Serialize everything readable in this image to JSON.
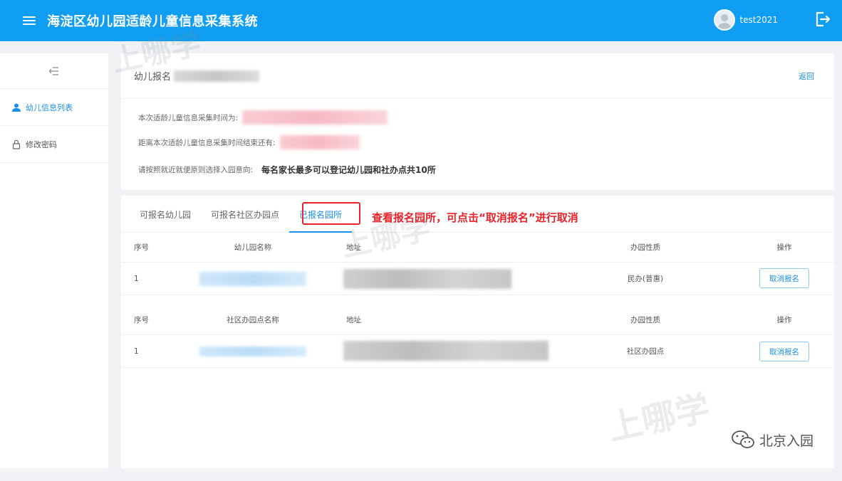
{
  "header": {
    "title": "海淀区幼儿园适龄儿童信息采集系统",
    "username": "test2021"
  },
  "sidebar": {
    "items": [
      {
        "label": "幼儿信息列表"
      },
      {
        "label": "修改密码"
      }
    ]
  },
  "summary": {
    "title": "幼儿报名",
    "back_label": "返回",
    "collect_time_label": "本次适龄儿童信息采集时间为:",
    "remaining_label": "距离本次适龄儿童信息采集时间结束还有:",
    "choose_label": "请按照就近就便原则选择入园意向:",
    "notice": "每名家长最多可以登记幼儿园和社办点共10所"
  },
  "tabs": [
    {
      "label": "可报名幼儿园"
    },
    {
      "label": "可报名社区办园点"
    },
    {
      "label": "已报名园所"
    }
  ],
  "annotation": "查看报名园所，可点击“取消报名”进行取消",
  "kindergarten_table": {
    "headers": [
      "序号",
      "幼儿园名称",
      "地址",
      "办园性质",
      "操作"
    ],
    "rows": [
      {
        "index": "1",
        "nature": "民办(普惠)",
        "action": "取消报名"
      }
    ]
  },
  "community_table": {
    "headers": [
      "序号",
      "社区办园点名称",
      "地址",
      "办园性质",
      "操作"
    ],
    "rows": [
      {
        "index": "1",
        "nature": "社区办园点",
        "action": "取消报名"
      }
    ]
  },
  "watermark": {
    "text": "上哪学"
  },
  "brand": {
    "text": "北京入园",
    "icon": "wechat-icon"
  },
  "colors": {
    "primary": "#0f9ef1",
    "link": "#1a8fe8",
    "annotation": "#e8232a"
  }
}
